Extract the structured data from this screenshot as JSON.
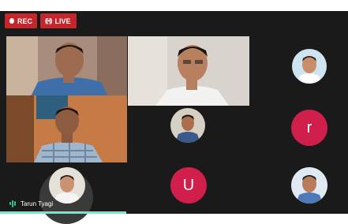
{
  "toolbar": {
    "rec_label": "REC",
    "live_label": "LIVE"
  },
  "speaker": {
    "name": "Tarun Tyagi"
  },
  "participants": {
    "letter_r": "r",
    "letter_u": "U"
  },
  "colors": {
    "badge_red": "#c3272b",
    "avatar_crimson": "#cf1f4a",
    "speaking_green": "#31c48d",
    "background": "#1a1a1a"
  }
}
